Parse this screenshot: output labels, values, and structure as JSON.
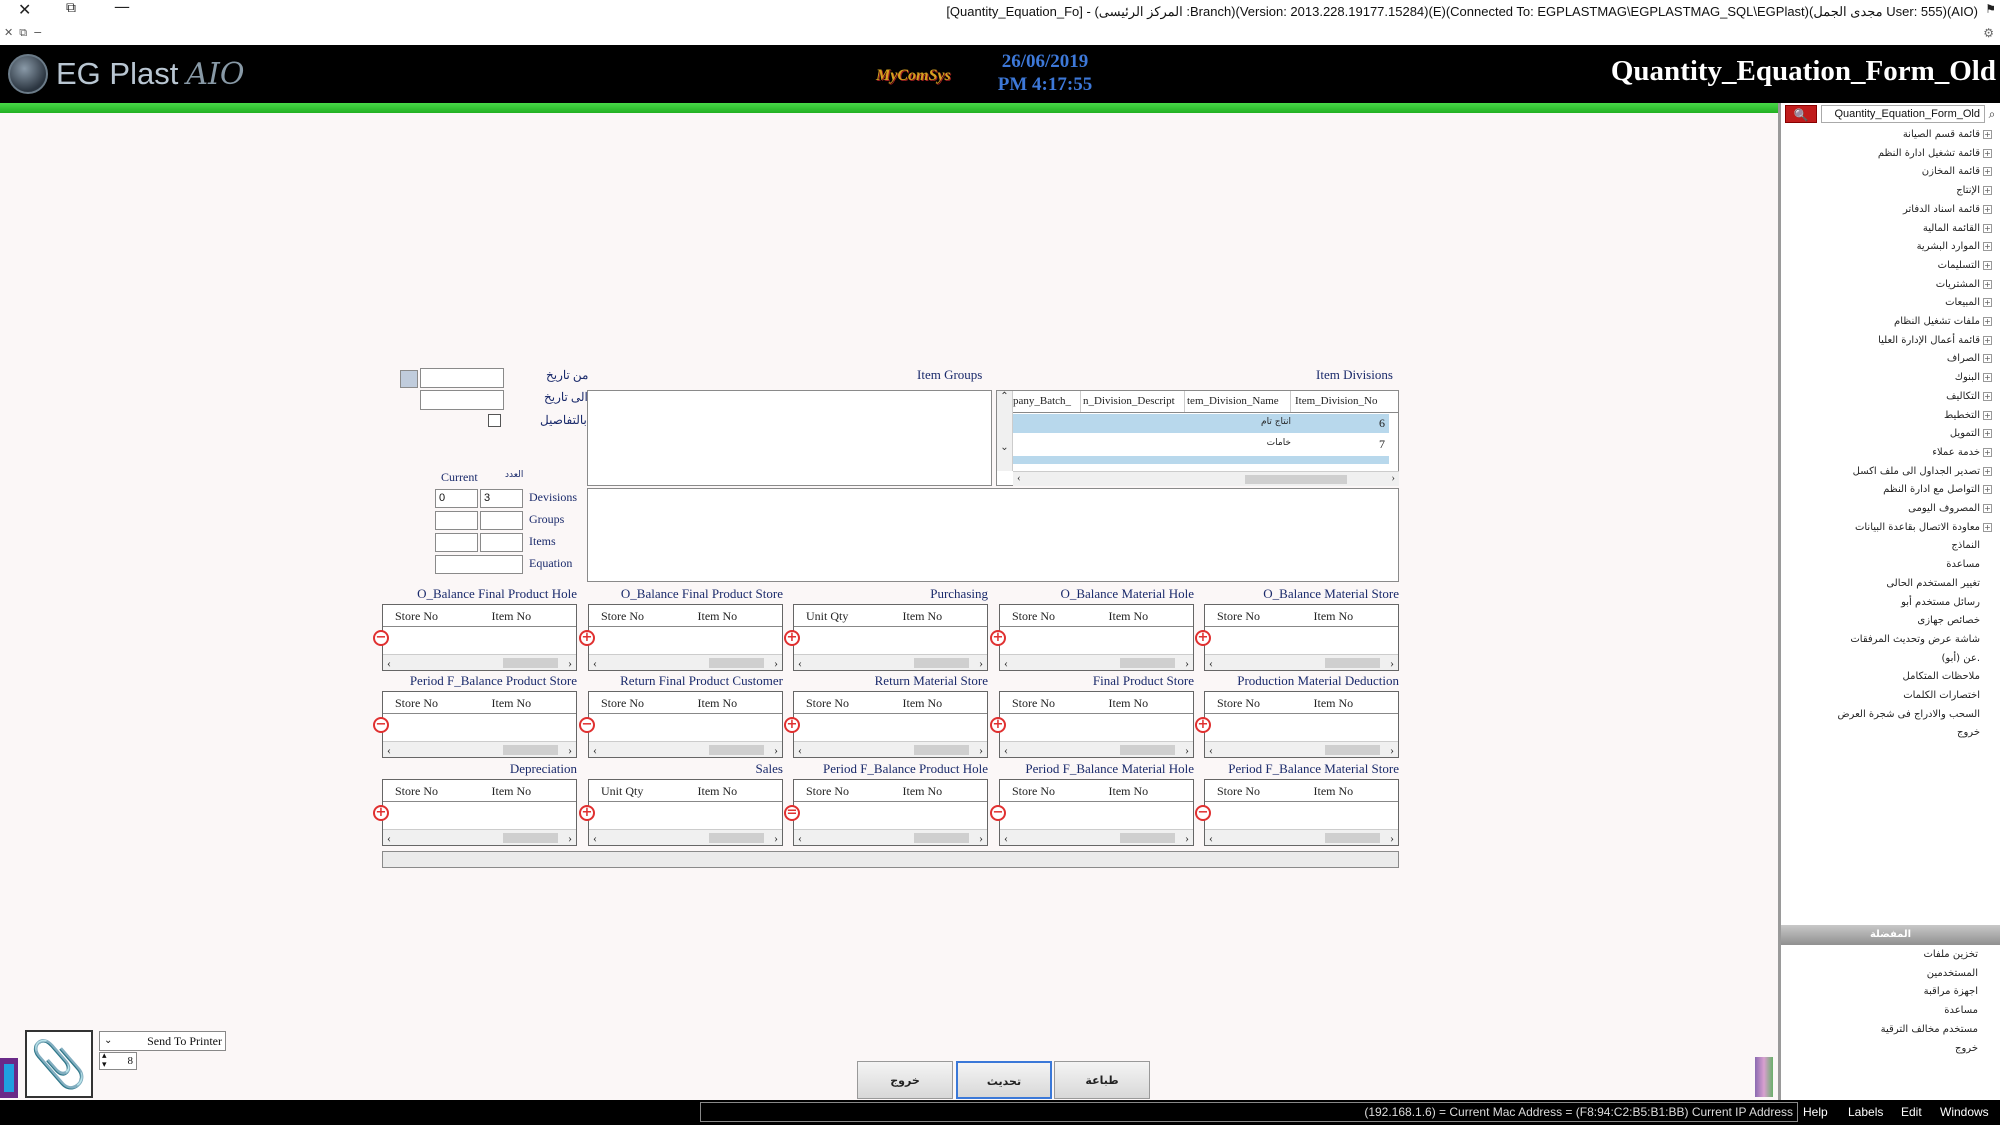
{
  "window": {
    "title": "[Quantity_Equation_Fo] - (المركز الرئيسى :Branch)(Version: 2013.228.19177.15284)(E)(Connected To: EGPLASTMAG\\EGPLASTMAG_SQL\\EGPlast)(مجدى الجمل User: 555)(AIO)"
  },
  "header": {
    "brand": "EG Plast",
    "brand_suffix": "AIO",
    "vendor": "MyComSys",
    "date": "26/06/2019",
    "time": "PM 4:17:55",
    "form_title": "Quantity_Equation_Form_Old"
  },
  "sidebar": {
    "search_value": "Quantity_Equation_Form_Old",
    "items": [
      "قائمة قسم الصيانة",
      "قائمة تشغيل ادارة النظم",
      "قائمة المخازن",
      "الإنتاج",
      "قائمة اسناد الدفاتر",
      "القائمة المالية",
      "الموارد البشرية",
      "التسليمات",
      "المشتريات",
      "المبيعات",
      "ملفات تشغيل النظام",
      "قائمة أعمال الإدارة العليا",
      "الصراف",
      "البنوك",
      "التكاليف",
      "التخطيط",
      "التمويل",
      "خدمة عملاء",
      "تصدير الجداول الى ملف اكسل",
      "التواصل مع ادارة النظم",
      "المصروف اليومى",
      "معاودة الاتصال بقاعدة البيانات",
      "النماذج",
      "مساعدة",
      "تغيير المستخدم الحالى",
      "رسائل مستخدم أبو",
      "خصائص جهازى",
      "شاشة عرض وتحديث المرفقات",
      "عن (أبو).",
      "ملاحظات المتكامل",
      "اختصارات الكلمات",
      "السحب والادراج فى شجرة العرض",
      "خروج"
    ],
    "favorites_title": "المفضلة",
    "favorites": [
      "تخزين ملفات",
      "المستخدمين",
      "اجهزة مراقبة",
      "مساعدة",
      "مستخدم مخالف الترقية",
      "خروج"
    ]
  },
  "form": {
    "from_date_label": "من تاريخ",
    "to_date_label": "الى تاريخ",
    "details_label": "بالتفاصيل",
    "item_groups_label": "Item Groups",
    "item_divisions_label": "Item Divisions",
    "divisions_grid": {
      "columns": [
        "pany_Batch_",
        "n_Division_Descript",
        "tem_Division_Name",
        "Item_Division_No"
      ],
      "rows": [
        {
          "name": "انتاج تام",
          "no": "6"
        },
        {
          "name": "خامات",
          "no": "7"
        }
      ]
    },
    "counts": {
      "current_label": "Current",
      "count_label": "العدد",
      "rows": [
        {
          "label": "Devisions",
          "current": "0",
          "count": "3"
        },
        {
          "label": "Groups",
          "current": "",
          "count": ""
        },
        {
          "label": "Items",
          "current": "",
          "count": ""
        },
        {
          "label": "Equation",
          "current": "",
          "count": ""
        }
      ]
    },
    "grid_rows": [
      [
        {
          "title": "O_Balance Final Product Hole",
          "cols": [
            "Store No",
            "Item No"
          ],
          "sign": "−"
        },
        {
          "title": "O_Balance Final Product Store",
          "cols": [
            "Store No",
            "Item No"
          ],
          "sign": "+"
        },
        {
          "title": "Purchasing",
          "cols": [
            "Unit Qty",
            "Item No"
          ],
          "sign": "+"
        },
        {
          "title": "O_Balance Material Hole",
          "cols": [
            "Store No",
            "Item No"
          ],
          "sign": "+"
        },
        {
          "title": "O_Balance Material Store",
          "cols": [
            "Store No",
            "Item No"
          ],
          "sign": "+"
        }
      ],
      [
        {
          "title": "Period F_Balance Product Store",
          "cols": [
            "Store No",
            "Item No"
          ],
          "sign": "−"
        },
        {
          "title": "Return Final Product Customer",
          "cols": [
            "Store No",
            "Item No"
          ],
          "sign": "−"
        },
        {
          "title": "Return Material Store",
          "cols": [
            "Store No",
            "Item No"
          ],
          "sign": "+"
        },
        {
          "title": "Final Product Store",
          "cols": [
            "Store No",
            "Item No"
          ],
          "sign": "+"
        },
        {
          "title": "Production Material Deduction",
          "cols": [
            "Store No",
            "Item No"
          ],
          "sign": "+"
        }
      ],
      [
        {
          "title": "Depreciation",
          "cols": [
            "Store No",
            "Item No"
          ],
          "sign": "+"
        },
        {
          "title": "Sales",
          "cols": [
            "Unit Qty",
            "Item No"
          ],
          "sign": "+"
        },
        {
          "title": "Period F_Balance Product Hole",
          "cols": [
            "Store No",
            "Item No"
          ],
          "sign": "="
        },
        {
          "title": "Period F_Balance Material Hole",
          "cols": [
            "Store No",
            "Item No"
          ],
          "sign": "−"
        },
        {
          "title": "Period F_Balance Material Store",
          "cols": [
            "Store No",
            "Item No"
          ],
          "sign": "−"
        }
      ]
    ]
  },
  "footer": {
    "printer_select": "Send To Printer",
    "copies": "8",
    "buttons": {
      "exit": "خروج",
      "refresh": "تحديث",
      "print": "طباعة"
    },
    "status_text": "(192.168.1.6) = Current Mac Address = (F8:94:C2:B5:B1:BB) Current IP Address",
    "menus": [
      "Help",
      "Labels",
      "Edit",
      "Windows"
    ]
  }
}
